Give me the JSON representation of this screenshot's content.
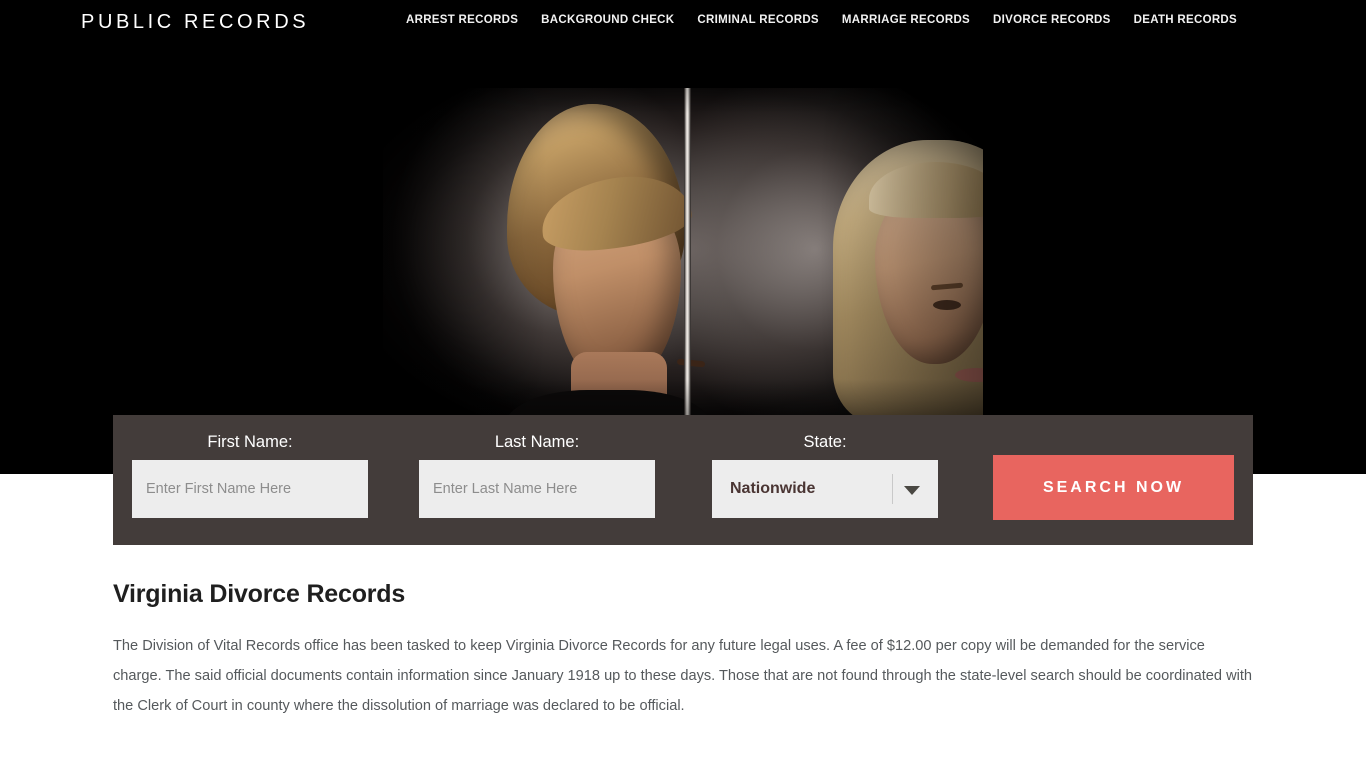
{
  "header": {
    "brand": "PUBLIC RECORDS",
    "nav": [
      {
        "label": "ARREST RECORDS"
      },
      {
        "label": "BACKGROUND CHECK"
      },
      {
        "label": "CRIMINAL RECORDS"
      },
      {
        "label": "MARRIAGE RECORDS"
      },
      {
        "label": "DIVORCE RECORDS"
      },
      {
        "label": "DEATH RECORDS"
      }
    ]
  },
  "search": {
    "first_name_label": "First Name:",
    "first_name_placeholder": "Enter First Name Here",
    "first_name_value": "",
    "last_name_label": "Last Name:",
    "last_name_placeholder": "Enter Last Name Here",
    "last_name_value": "",
    "state_label": "State:",
    "state_selected": "Nationwide",
    "submit_label": "SEARCH NOW"
  },
  "main": {
    "title": "Virginia Divorce Records",
    "paragraph_1": "The Division of Vital Records office has been tasked to keep Virginia Divorce Records for any future legal uses. A fee of $12.00 per copy will be demanded for the service charge. The said official documents contain information since January 1918 up to these days. Those that are not found through the state-level search should be coordinated with the Clerk of Court in county where the dissolution of marriage was declared to be official."
  },
  "colors": {
    "accent": "#e8655f",
    "form_bar": "#433c3a",
    "hero_background": "#000000",
    "input_background": "#ededed",
    "body_text": "#55595c"
  }
}
